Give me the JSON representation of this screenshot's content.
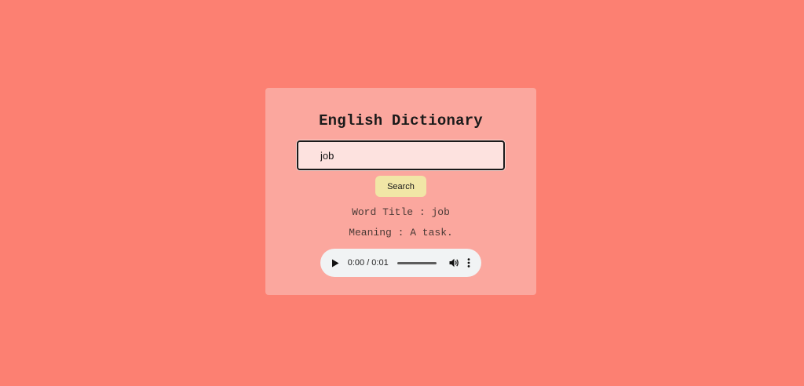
{
  "app": {
    "title": "English Dictionary"
  },
  "search": {
    "value": "job",
    "button_label": "Search"
  },
  "result": {
    "word_line": "Word Title : job",
    "meaning_line": "Meaning : A task."
  },
  "audio": {
    "time": "0:00 / 0:01",
    "progress": 0,
    "play_icon": "play-icon",
    "volume_icon": "volume-icon",
    "more_icon": "more-vert-icon"
  },
  "colors": {
    "page_background": "#fc8072",
    "card_background": "#fba79e",
    "input_background": "#fde2df",
    "button_background": "#f1e6a6",
    "player_background": "#f1f3f4"
  }
}
